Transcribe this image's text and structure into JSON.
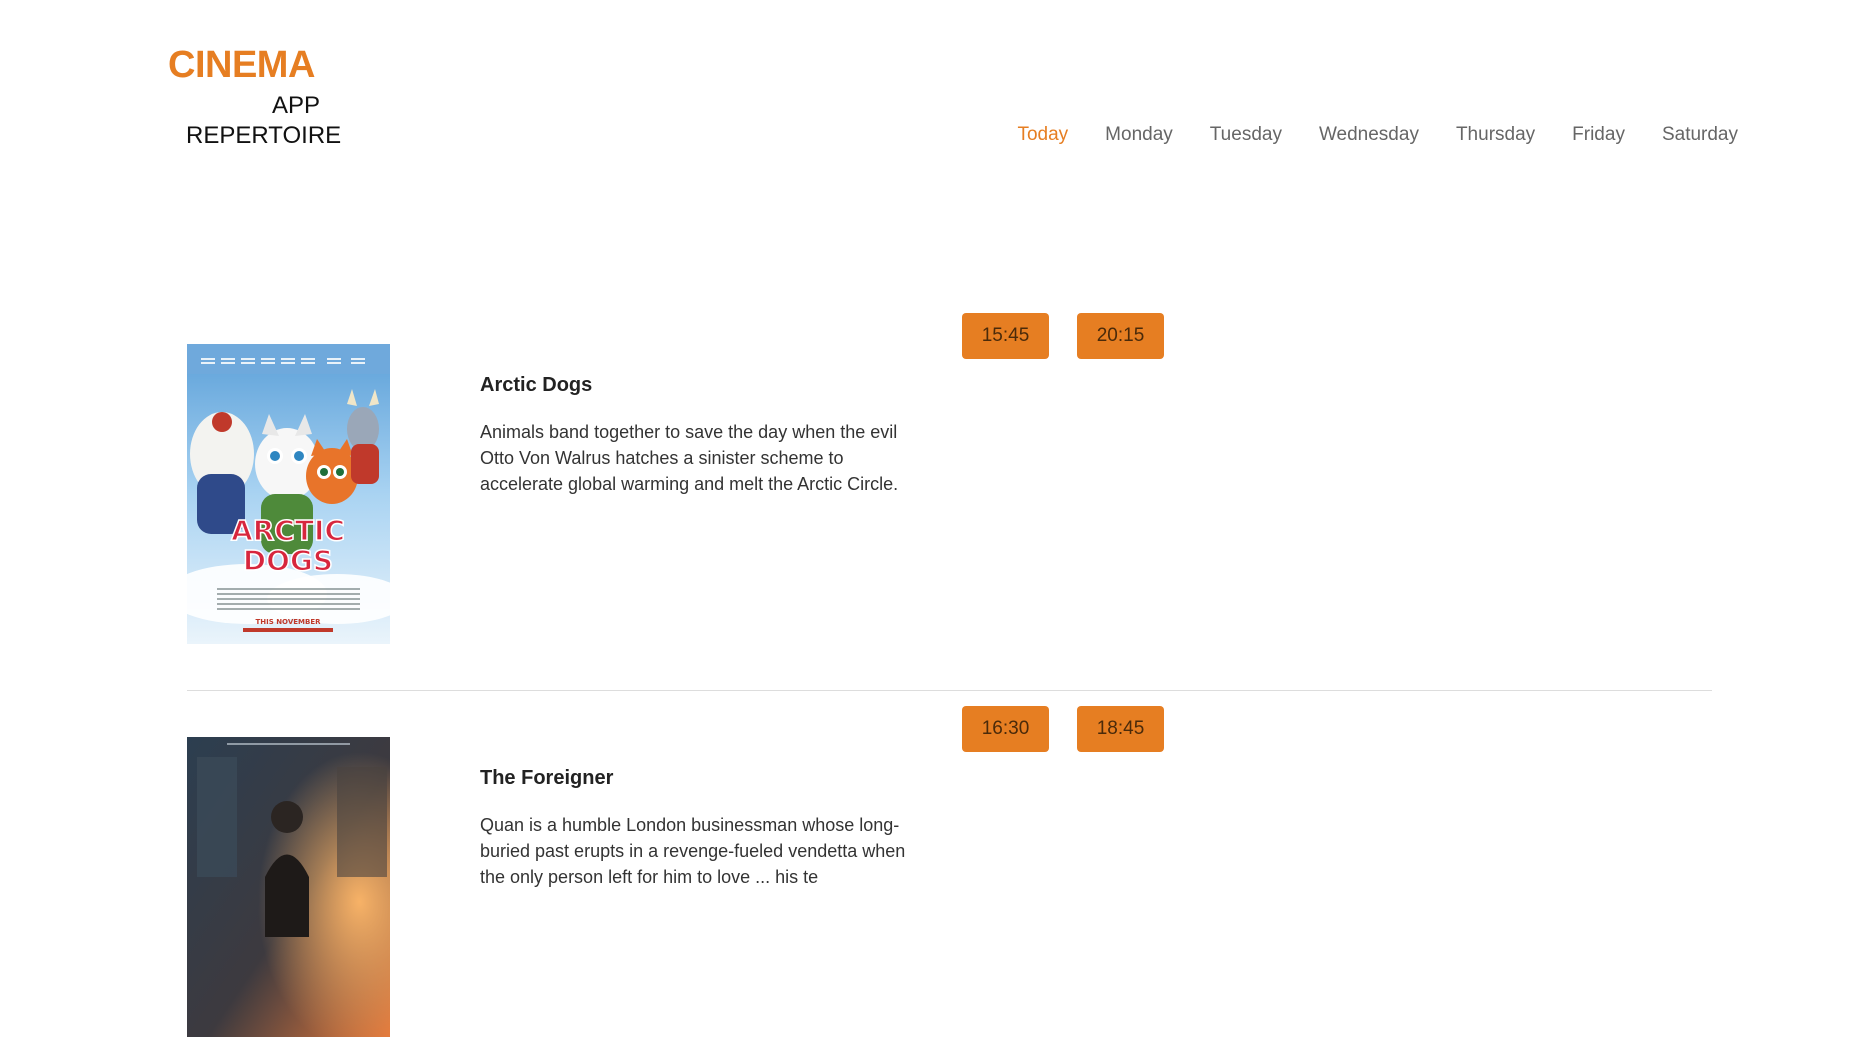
{
  "logo": {
    "cinema": "CINEMA",
    "app": "APP",
    "repertoire": "REPERTOIRE"
  },
  "nav": {
    "items": [
      "Today",
      "Monday",
      "Tuesday",
      "Wednesday",
      "Thursday",
      "Friday",
      "Saturday"
    ],
    "active": "Today"
  },
  "movies": [
    {
      "title": "Arctic Dogs",
      "description": "Animals band together to save the day when the evil Otto Von Walrus hatches a sinister scheme to accelerate global warming and melt the Arctic Circle.",
      "times": [
        "15:45",
        "20:15"
      ],
      "poster": {
        "title_text": "ARCTIC DOGS",
        "tagline": "THIS NOVEMBER"
      }
    },
    {
      "title": "The Foreigner",
      "description": "Quan is a humble London businessman whose long-buried past erupts in a revenge-fueled vendetta when the only person left for him to love ... his te",
      "times": [
        "16:30",
        "18:45"
      ]
    }
  ],
  "colors": {
    "accent": "#e67e22",
    "nav_inactive": "#666666",
    "divider": "#dddddd"
  }
}
